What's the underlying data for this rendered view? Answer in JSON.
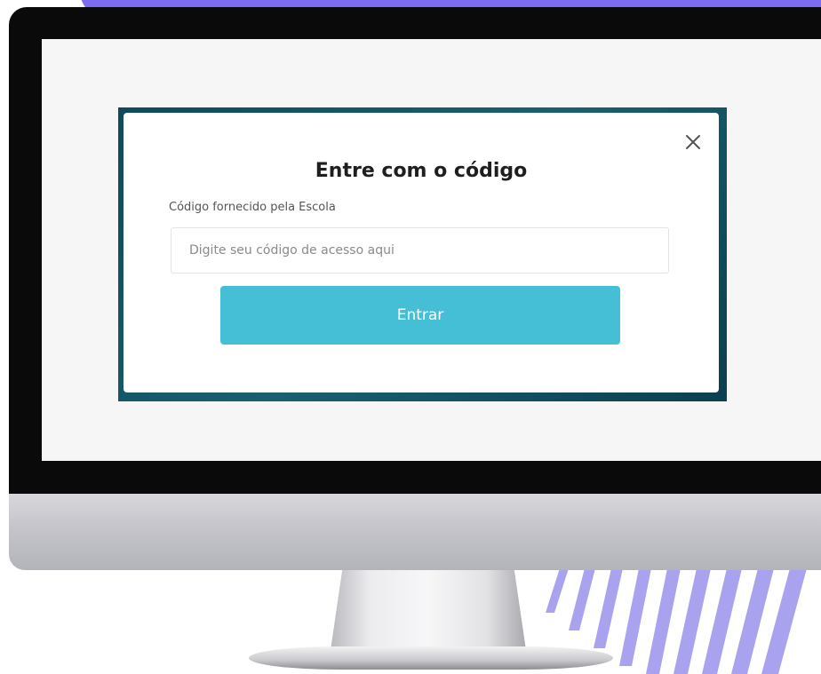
{
  "modal": {
    "title": "Entre com o código",
    "field_label": "Código fornecido pela Escola",
    "input_placeholder": "Digite seu código de acesso aqui",
    "input_value": "",
    "submit_label": "Entrar",
    "close_icon": "close-icon"
  },
  "colors": {
    "accent_button": "#45bfd6",
    "decor_purple": "#7b6cf0",
    "backdrop_teal": "#0e4a5c"
  }
}
